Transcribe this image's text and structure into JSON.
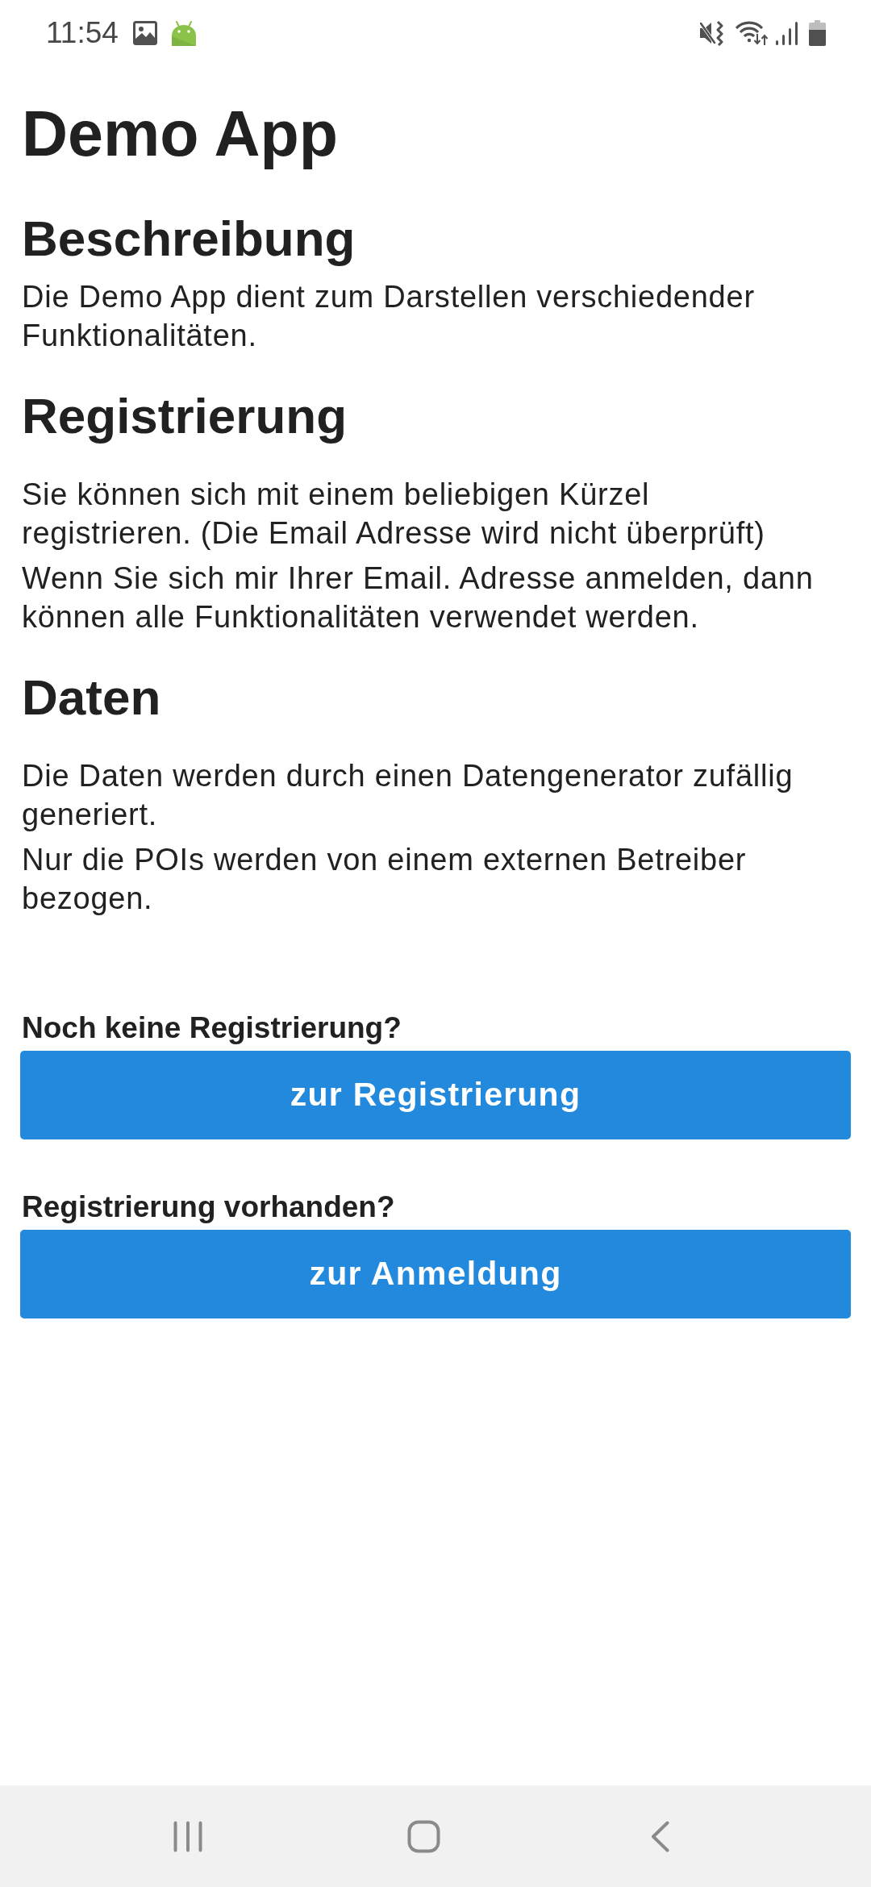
{
  "status_bar": {
    "time": "11:54"
  },
  "title": "Demo App",
  "sections": [
    {
      "heading": "Beschreibung",
      "paragraphs": [
        "Die Demo App dient zum Darstellen verschiedender Funktionalitäten."
      ]
    },
    {
      "heading": "Registrierung",
      "paragraphs": [
        "Sie können sich mit einem beliebigen Kürzel registrieren. (Die Email Adresse wird nicht überprüft)",
        "Wenn Sie sich mir Ihrer Email. Adresse anmelden, dann können alle Funktionalitäten verwendet werden."
      ]
    },
    {
      "heading": "Daten",
      "paragraphs": [
        "Die Daten werden durch einen Datengenerator zufällig generiert.",
        "Nur die POIs werden von einem externen Betreiber bezogen."
      ]
    }
  ],
  "actions": [
    {
      "prompt": "Noch keine Registrierung?",
      "button": "zur Registrierung"
    },
    {
      "prompt": "Registrierung vorhanden?",
      "button": "zur Anmeldung"
    }
  ]
}
